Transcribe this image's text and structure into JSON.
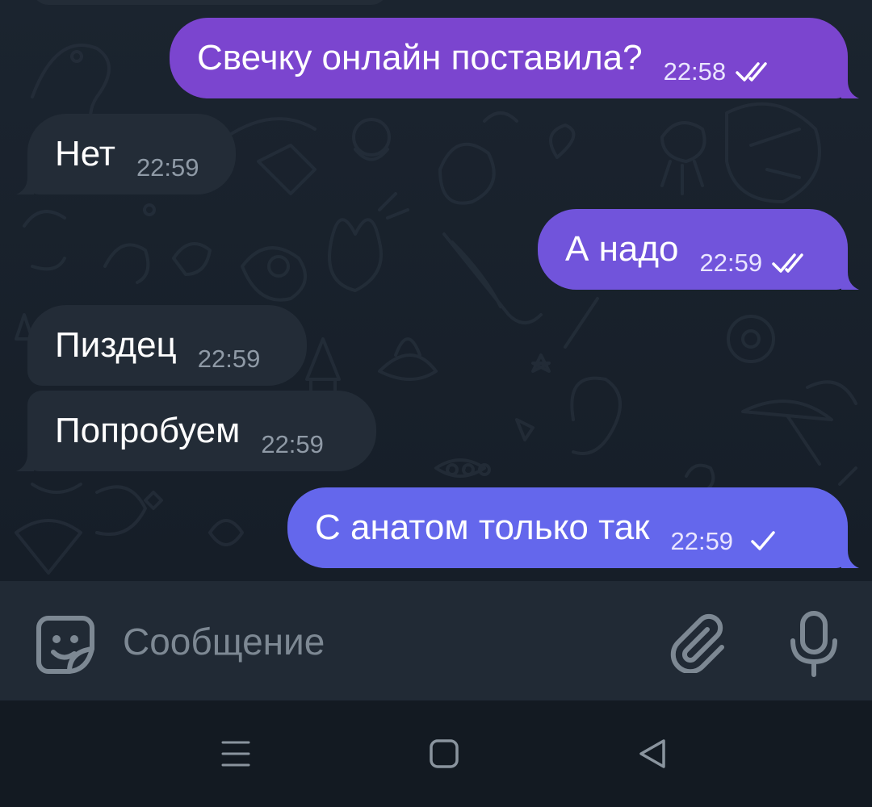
{
  "messages": [
    {
      "direction": "outgoing",
      "text": "Свечку онлайн поставила?",
      "time": "22:58",
      "status": "read",
      "color": "#7b45cf"
    },
    {
      "direction": "incoming",
      "text": "Нет",
      "time": "22:59",
      "color": "#232c37"
    },
    {
      "direction": "outgoing",
      "text": "А надо",
      "time": "22:59",
      "status": "read",
      "color": "#7154db"
    },
    {
      "direction": "incoming",
      "text": "Пиздец",
      "time": "22:59",
      "color": "#232c37"
    },
    {
      "direction": "incoming",
      "text": "Попробуем",
      "time": "22:59",
      "color": "#232c37"
    },
    {
      "direction": "outgoing",
      "text": "С анатом только так",
      "time": "22:59",
      "status": "sent",
      "color": "#6467ec"
    }
  ],
  "composer": {
    "placeholder": "Сообщение",
    "left_icon": "sticker-icon",
    "right_icons": [
      "paperclip-icon",
      "microphone-icon"
    ]
  },
  "system_nav": {
    "buttons": [
      "recent-apps-icon",
      "home-icon",
      "back-icon"
    ]
  },
  "colors": {
    "chat_background": "#18212b",
    "incoming_bubble": "#232c37",
    "input_bar": "#212a35",
    "nav_bar": "#131a22",
    "timestamp_incoming": "#8f9aa6"
  }
}
